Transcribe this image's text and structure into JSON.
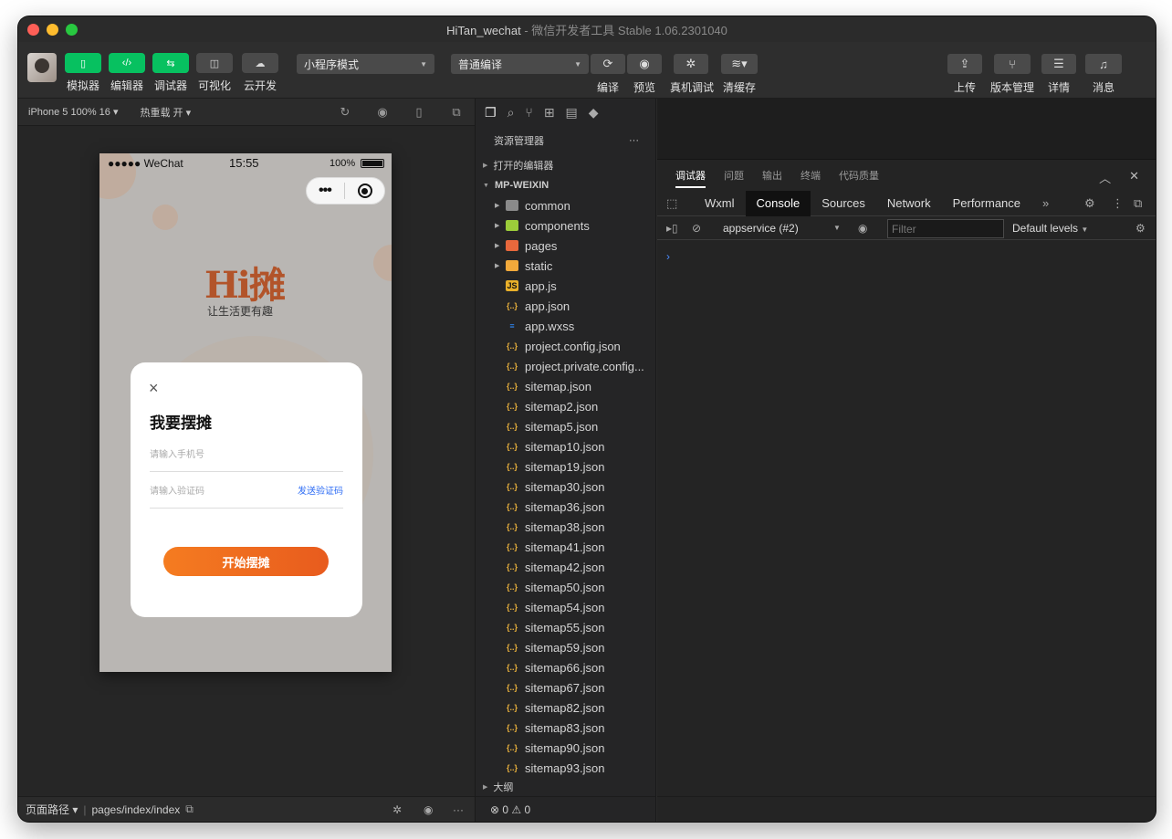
{
  "window": {
    "title": "HiTan_wechat",
    "title_suffix": " - 微信开发者工具 Stable 1.06.2301040"
  },
  "colors": {
    "green": "#07c160",
    "accent_orange": "#f57c20",
    "link_blue": "#2d6cf5"
  },
  "toolbar": {
    "mode_buttons": [
      {
        "label": "模拟器",
        "icon": "phone-icon"
      },
      {
        "label": "编辑器",
        "icon": "code-icon"
      },
      {
        "label": "调试器",
        "icon": "debugger-icon"
      },
      {
        "label": "可视化",
        "icon": "layout-icon"
      },
      {
        "label": "云开发",
        "icon": "cloud-icon"
      }
    ],
    "mode_select": "小程序模式",
    "compile_select": "普通编译",
    "compile_label": "编译",
    "preview_label": "预览",
    "remote_debug_label": "真机调试",
    "clear_cache_label": "清缓存",
    "upload_label": "上传",
    "version_label": "版本管理",
    "details_label": "详情",
    "messages_label": "消息"
  },
  "simulator": {
    "device": "iPhone 5 100% 16",
    "hot_reload": "热重载 开",
    "status_carrier": "●●●●● WeChat",
    "status_time": "15:55",
    "status_battery": "100%",
    "logo_text": "Hi摊",
    "slogan": "让生活更有趣",
    "dialog": {
      "close": "×",
      "title": "我要摆摊",
      "phone_placeholder": "请输入手机号",
      "code_placeholder": "请输入验证码",
      "send_code": "发送验证码",
      "submit": "开始摆摊"
    },
    "footer": {
      "path_label": "页面路径",
      "path": "pages/index/index"
    }
  },
  "explorer": {
    "title": "资源管理器",
    "more": "···",
    "open_editors": "打开的编辑器",
    "project": "MP-WEIXIN",
    "folders": [
      {
        "name": "common",
        "type": "folder"
      },
      {
        "name": "components",
        "type": "folder-green"
      },
      {
        "name": "pages",
        "type": "folder-red"
      },
      {
        "name": "static",
        "type": "folder-orange"
      }
    ],
    "files": [
      {
        "name": "app.js",
        "type": "js"
      },
      {
        "name": "app.json",
        "type": "json"
      },
      {
        "name": "app.wxss",
        "type": "css"
      },
      {
        "name": "project.config.json",
        "type": "json"
      },
      {
        "name": "project.private.config...",
        "type": "json"
      },
      {
        "name": "sitemap.json",
        "type": "json"
      },
      {
        "name": "sitemap2.json",
        "type": "json"
      },
      {
        "name": "sitemap5.json",
        "type": "json"
      },
      {
        "name": "sitemap10.json",
        "type": "json"
      },
      {
        "name": "sitemap19.json",
        "type": "json"
      },
      {
        "name": "sitemap30.json",
        "type": "json"
      },
      {
        "name": "sitemap36.json",
        "type": "json"
      },
      {
        "name": "sitemap38.json",
        "type": "json"
      },
      {
        "name": "sitemap41.json",
        "type": "json"
      },
      {
        "name": "sitemap42.json",
        "type": "json"
      },
      {
        "name": "sitemap50.json",
        "type": "json"
      },
      {
        "name": "sitemap54.json",
        "type": "json"
      },
      {
        "name": "sitemap55.json",
        "type": "json"
      },
      {
        "name": "sitemap59.json",
        "type": "json"
      },
      {
        "name": "sitemap66.json",
        "type": "json"
      },
      {
        "name": "sitemap67.json",
        "type": "json"
      },
      {
        "name": "sitemap82.json",
        "type": "json"
      },
      {
        "name": "sitemap83.json",
        "type": "json"
      },
      {
        "name": "sitemap90.json",
        "type": "json"
      },
      {
        "name": "sitemap93.json",
        "type": "json"
      }
    ],
    "outline": "大纲",
    "status": "⊗ 0 ⚠ 0"
  },
  "devtools": {
    "tabs": [
      "调试器",
      "问题",
      "输出",
      "终端",
      "代码质量"
    ],
    "panels": [
      "Wxml",
      "Console",
      "Sources",
      "Network",
      "Performance"
    ],
    "more_panels": "»",
    "context": "appservice (#2)",
    "filter_placeholder": "Filter",
    "levels": "Default levels",
    "prompt": "›"
  }
}
